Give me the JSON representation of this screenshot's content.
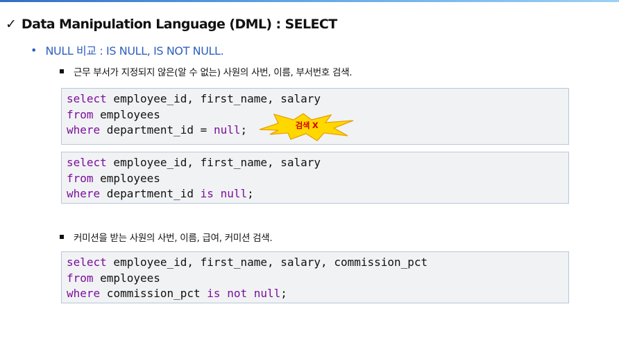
{
  "slide": {
    "title": "Data Manipulation Language (DML) : SELECT",
    "subtitle": "NULL 비교 : IS NULL, IS NOT NULL.",
    "bullet_1": "근무 부서가 지정되지 않은(알 수 없는) 사원의 사번, 이름, 부서번호 검색.",
    "bullet_2": "커미션을 받는 사원의 사번, 이름, 급여, 커미션 검색."
  },
  "code_1": {
    "line_1": {
      "kw": "select",
      "text": " employee_id, first_name, salary"
    },
    "line_2": {
      "kw": "from",
      "text": " employees"
    },
    "line_3": {
      "kw": "where",
      "text": " department_id = ",
      "kw2": "null",
      "end": ";"
    }
  },
  "annotation": {
    "label": "검색 X"
  },
  "code_2": {
    "line_1": {
      "kw": "select",
      "text": " employee_id, first_name, salary"
    },
    "line_2": {
      "kw": "from",
      "text": " employees"
    },
    "line_3": {
      "kw": "where",
      "text": " department_id ",
      "kw2": "is null",
      "end": ";"
    }
  },
  "code_3": {
    "line_1": {
      "kw": "select",
      "text": " employee_id, first_name, salary, commission_pct"
    },
    "line_2": {
      "kw": "from",
      "text": " employees"
    },
    "line_3": {
      "kw": "where",
      "text": " commission_pct ",
      "kw2": "is not null",
      "end": ";"
    }
  },
  "colors": {
    "keyword": "#7a0e9b",
    "subtitle": "#2f5fbf",
    "burst_fill": "#ffd800",
    "burst_stroke": "#e8a000",
    "burst_text": "#d40000"
  },
  "icons": {
    "heading_marker": "checkmark-icon",
    "subtitle_marker": "bullet-dot",
    "item_marker": "square-bullet"
  }
}
